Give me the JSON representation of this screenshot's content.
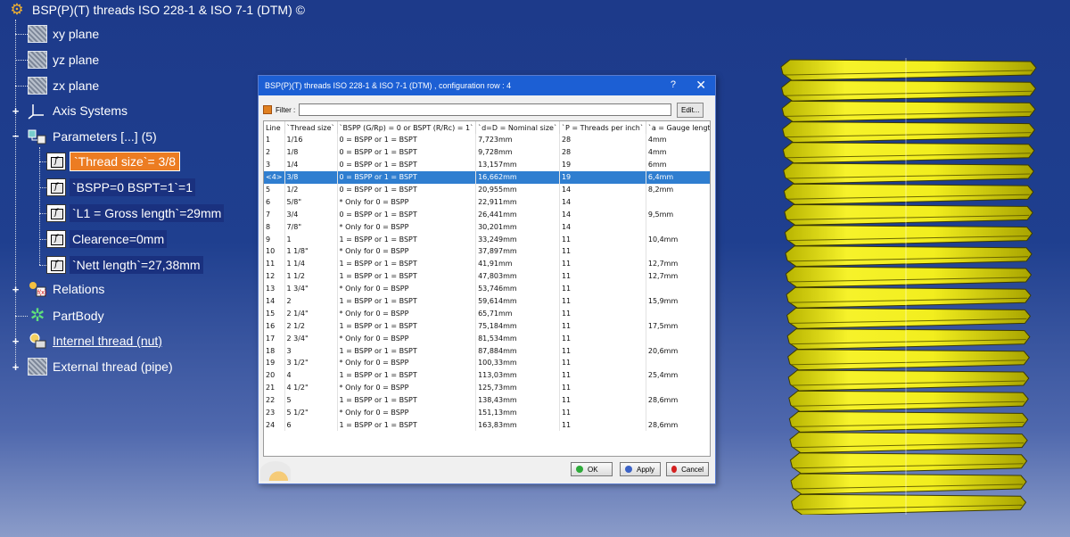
{
  "tree": {
    "root_label": "BSP(P)(T) threads ISO 228-1 & ISO 7-1 (DTM) ©",
    "xy_plane": "xy plane",
    "yz_plane": "yz plane",
    "zx_plane": "zx plane",
    "axis_systems": "Axis Systems",
    "parameters": "Parameters [...] (5)",
    "params": [
      "`Thread size`= 3/8",
      "`BSPP=0 BSPT=1`=1",
      "`L1 = Gross length`=29mm",
      "Clearence=0mm",
      "`Nett length`=27,38mm"
    ],
    "relations": "Relations",
    "partbody": "PartBody",
    "internal_thread": "Internel thread (nut)",
    "external_thread": "External thread (pipe)"
  },
  "dialog": {
    "title": "BSP(P)(T) threads ISO 228-1 & ISO 7-1 (DTM) , configuration row : 4",
    "help": "?",
    "close": "✕",
    "filter_label": "Filter :",
    "filter_value": "",
    "edit_button": "Edit...",
    "ok_button": "OK",
    "apply_button": "Apply",
    "cancel_button": "Cancel",
    "columns": [
      "Line",
      "`Thread size`",
      "`BSPP (G/Rp) = 0 or BSPT (R/Rc) = 1`",
      "`d=D = Nominal size`",
      "`P = Threads per inch`",
      "`a = Gauge length`"
    ],
    "selected_row": 3,
    "rows": [
      [
        "1",
        "1/16",
        "0 = BSPP or 1 = BSPT",
        "7,723mm",
        "28",
        "4mm"
      ],
      [
        "2",
        "1/8",
        "0 = BSPP or 1 = BSPT",
        "9,728mm",
        "28",
        "4mm"
      ],
      [
        "3",
        "1/4",
        "0 = BSPP or 1 = BSPT",
        "13,157mm",
        "19",
        "6mm"
      ],
      [
        "<4>",
        "3/8",
        "0 = BSPP or 1 = BSPT",
        "16,662mm",
        "19",
        "6,4mm"
      ],
      [
        "5",
        "1/2",
        "0 = BSPP or 1 = BSPT",
        "20,955mm",
        "14",
        "8,2mm"
      ],
      [
        "6",
        "5/8\"",
        "* Only for 0 = BSPP",
        "22,911mm",
        "14",
        ""
      ],
      [
        "7",
        "3/4",
        "0 = BSPP or 1 = BSPT",
        "26,441mm",
        "14",
        "9,5mm"
      ],
      [
        "8",
        "7/8\"",
        "* Only for 0 = BSPP",
        "30,201mm",
        "14",
        ""
      ],
      [
        "9",
        "1",
        "1 = BSPP or 1 = BSPT",
        "33,249mm",
        "11",
        "10,4mm"
      ],
      [
        "10",
        "1 1/8\"",
        "* Only for 0 = BSPP",
        "37,897mm",
        "11",
        ""
      ],
      [
        "11",
        "1 1/4",
        "1 = BSPP or 1 = BSPT",
        "41,91mm",
        "11",
        "12,7mm"
      ],
      [
        "12",
        "1 1/2",
        "1 = BSPP or 1 = BSPT",
        "47,803mm",
        "11",
        "12,7mm"
      ],
      [
        "13",
        "1 3/4\"",
        "* Only for 0 = BSPP",
        "53,746mm",
        "11",
        ""
      ],
      [
        "14",
        "2",
        "1 = BSPP or 1 = BSPT",
        "59,614mm",
        "11",
        "15,9mm"
      ],
      [
        "15",
        "2 1/4\"",
        "* Only for 0 = BSPP",
        "65,71mm",
        "11",
        ""
      ],
      [
        "16",
        "2 1/2",
        "1 = BSPP or 1 = BSPT",
        "75,184mm",
        "11",
        "17,5mm"
      ],
      [
        "17",
        "2 3/4\"",
        "* Only for 0 = BSPP",
        "81,534mm",
        "11",
        ""
      ],
      [
        "18",
        "3",
        "1 = BSPP or 1 = BSPT",
        "87,884mm",
        "11",
        "20,6mm"
      ],
      [
        "19",
        "3 1/2\"",
        "* Only for 0 = BSPP",
        "100,33mm",
        "11",
        ""
      ],
      [
        "20",
        "4",
        "1 = BSPP or 1 = BSPT",
        "113,03mm",
        "11",
        "25,4mm"
      ],
      [
        "21",
        "4 1/2\"",
        "* Only for 0 = BSPP",
        "125,73mm",
        "11",
        ""
      ],
      [
        "22",
        "5",
        "1 = BSPP or 1 = BSPT",
        "138,43mm",
        "11",
        "28,6mm"
      ],
      [
        "23",
        "5 1/2\"",
        "* Only for 0 = BSPP",
        "151,13mm",
        "11",
        ""
      ],
      [
        "24",
        "6",
        "1 = BSPP or 1 = BSPT",
        "163,83mm",
        "11",
        "28,6mm"
      ]
    ]
  },
  "colors": {
    "selection_orange": "#ec7c22",
    "row_highlight": "#2f7ed0",
    "thread_yellow": "#f2ee1e",
    "title_bar": "#1c5fd4"
  }
}
